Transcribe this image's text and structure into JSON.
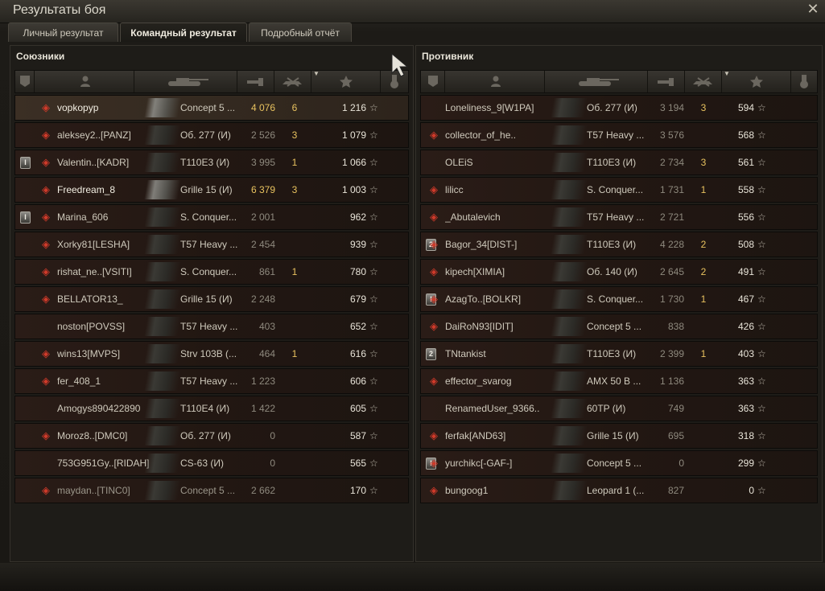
{
  "window": {
    "title": "Результаты боя"
  },
  "tabs": [
    {
      "label": "Личный результат",
      "active": false
    },
    {
      "label": "Командный результат",
      "active": true
    },
    {
      "label": "Подробный отчёт",
      "active": false
    }
  ],
  "allies": {
    "title": "Союзники",
    "players": [
      {
        "name": "vopkopyp",
        "tank": "Concept 5 ...",
        "damage": "4 076",
        "kills": "6",
        "xp": "1 216",
        "rank": "",
        "badge": "clan-icon",
        "self": true,
        "damage_gold": true
      },
      {
        "name": "aleksey2..[PANZ]",
        "tank": "Об. 277 (И)",
        "damage": "2 526",
        "kills": "3",
        "xp": "1 079",
        "rank": "",
        "badge": "clan-icon"
      },
      {
        "name": "Valentin..[KADR]",
        "tank": "T110E3 (И)",
        "damage": "3 995",
        "kills": "1",
        "xp": "1 066",
        "rank": "I",
        "badge": "clan-icon"
      },
      {
        "name": "Freedream_8",
        "tank": "Grille 15 (И)",
        "damage": "6 379",
        "kills": "3",
        "xp": "1 003",
        "rank": "",
        "badge": "clan-icon",
        "damage_gold": true,
        "bright": true
      },
      {
        "name": "Marina_606",
        "tank": "S. Conquer...",
        "damage": "2 001",
        "kills": "",
        "xp": "962",
        "rank": "I",
        "badge": "clan-icon"
      },
      {
        "name": "Xorky81[LESHA]",
        "tank": "T57 Heavy ...",
        "damage": "2 454",
        "kills": "",
        "xp": "939",
        "rank": "",
        "badge": "clan-icon"
      },
      {
        "name": "rishat_ne..[VSITI]",
        "tank": "S. Conquer...",
        "damage": "861",
        "kills": "1",
        "xp": "780",
        "rank": "",
        "badge": "clan-icon"
      },
      {
        "name": "BELLATOR13_",
        "tank": "Grille 15 (И)",
        "damage": "2 248",
        "kills": "",
        "xp": "679",
        "rank": "",
        "badge": "clan-icon"
      },
      {
        "name": "noston[POVSS]",
        "tank": "T57 Heavy ...",
        "damage": "403",
        "kills": "",
        "xp": "652",
        "rank": "",
        "badge": ""
      },
      {
        "name": "wins13[MVPS]",
        "tank": "Strv 103B (...",
        "damage": "464",
        "kills": "1",
        "xp": "616",
        "rank": "",
        "badge": "clan-icon"
      },
      {
        "name": "fer_408_1",
        "tank": "T57 Heavy ...",
        "damage": "1 223",
        "kills": "",
        "xp": "606",
        "rank": "",
        "badge": "clan-icon"
      },
      {
        "name": "Amogys890422890",
        "tank": "T110E4 (И)",
        "damage": "1 422",
        "kills": "",
        "xp": "605",
        "rank": "",
        "badge": ""
      },
      {
        "name": "Moroz8..[DMC0]",
        "tank": "Об. 277 (И)",
        "damage": "0",
        "kills": "",
        "xp": "587",
        "rank": "",
        "badge": "clan-icon"
      },
      {
        "name": "753G951Gy..[RIDAH]",
        "tank": "CS-63 (И)",
        "damage": "0",
        "kills": "",
        "xp": "565",
        "rank": "",
        "badge": ""
      },
      {
        "name": "maydan..[TINC0]",
        "tank": "Concept 5 ...",
        "damage": "2 662",
        "kills": "",
        "xp": "170",
        "rank": "",
        "badge": "clan-icon",
        "dead": true
      }
    ]
  },
  "enemies": {
    "title": "Противник",
    "players": [
      {
        "name": "Loneliness_9[W1PA]",
        "tank": "Об. 277 (И)",
        "damage": "3 194",
        "kills": "3",
        "xp": "594",
        "rank": "",
        "badge": ""
      },
      {
        "name": "collector_of_he..",
        "tank": "T57 Heavy ...",
        "damage": "3 576",
        "kills": "",
        "xp": "568",
        "rank": "",
        "badge": "clan-icon"
      },
      {
        "name": "OLEiS",
        "tank": "T110E3 (И)",
        "damage": "2 734",
        "kills": "3",
        "xp": "561",
        "rank": "",
        "badge": ""
      },
      {
        "name": "lilicc",
        "tank": "S. Conquer...",
        "damage": "1 731",
        "kills": "1",
        "xp": "558",
        "rank": "",
        "badge": "clan-icon"
      },
      {
        "name": "_Abutalevich",
        "tank": "T57 Heavy ...",
        "damage": "2 721",
        "kills": "",
        "xp": "556",
        "rank": "",
        "badge": "clan-icon"
      },
      {
        "name": "Bagor_34[DIST-]",
        "tank": "T110E3 (И)",
        "damage": "4 228",
        "kills": "2",
        "xp": "508",
        "rank": "2",
        "badge": "clan-icon"
      },
      {
        "name": "kipech[XIMIA]",
        "tank": "Об. 140 (И)",
        "damage": "2 645",
        "kills": "2",
        "xp": "491",
        "rank": "",
        "badge": "clan-icon"
      },
      {
        "name": "AzagTo..[BOLKR]",
        "tank": "S. Conquer...",
        "damage": "1 730",
        "kills": "1",
        "xp": "467",
        "rank": "I",
        "badge": "clan-icon"
      },
      {
        "name": "DaiRoN93[IDIT]",
        "tank": "Concept 5 ...",
        "damage": "838",
        "kills": "",
        "xp": "426",
        "rank": "",
        "badge": "clan-icon"
      },
      {
        "name": "TNtankist",
        "tank": "T110E3 (И)",
        "damage": "2 399",
        "kills": "1",
        "xp": "403",
        "rank": "2",
        "badge": ""
      },
      {
        "name": "effector_svarog",
        "tank": "AMX 50 B ...",
        "damage": "1 136",
        "kills": "",
        "xp": "363",
        "rank": "",
        "badge": "clan-icon"
      },
      {
        "name": "RenamedUser_9366..",
        "tank": "60TP (И)",
        "damage": "749",
        "kills": "",
        "xp": "363",
        "rank": "",
        "badge": ""
      },
      {
        "name": "ferfak[AND63]",
        "tank": "Grille 15 (И)",
        "damage": "695",
        "kills": "",
        "xp": "318",
        "rank": "",
        "badge": "clan-icon"
      },
      {
        "name": "yurchikc[-GAF-]",
        "tank": "Concept 5 ...",
        "damage": "0",
        "kills": "",
        "xp": "299",
        "rank": "I",
        "badge": "clan-icon"
      },
      {
        "name": "bungoog1",
        "tank": "Leopard 1 (...",
        "damage": "827",
        "kills": "",
        "xp": "0",
        "rank": "",
        "badge": "clan-icon"
      }
    ]
  },
  "icons": {
    "close": "close-icon",
    "star": "star-icon",
    "rank_column": "rank-icon",
    "player_column": "player-icon",
    "tank_column": "tank-icon",
    "damage_column": "damage-icon",
    "kills_column": "kills-icon",
    "xp_column": "xp-star-icon",
    "medal_column": "medal-icon"
  },
  "colors": {
    "gold": "#e8c25f",
    "row_bg": "#221712"
  }
}
